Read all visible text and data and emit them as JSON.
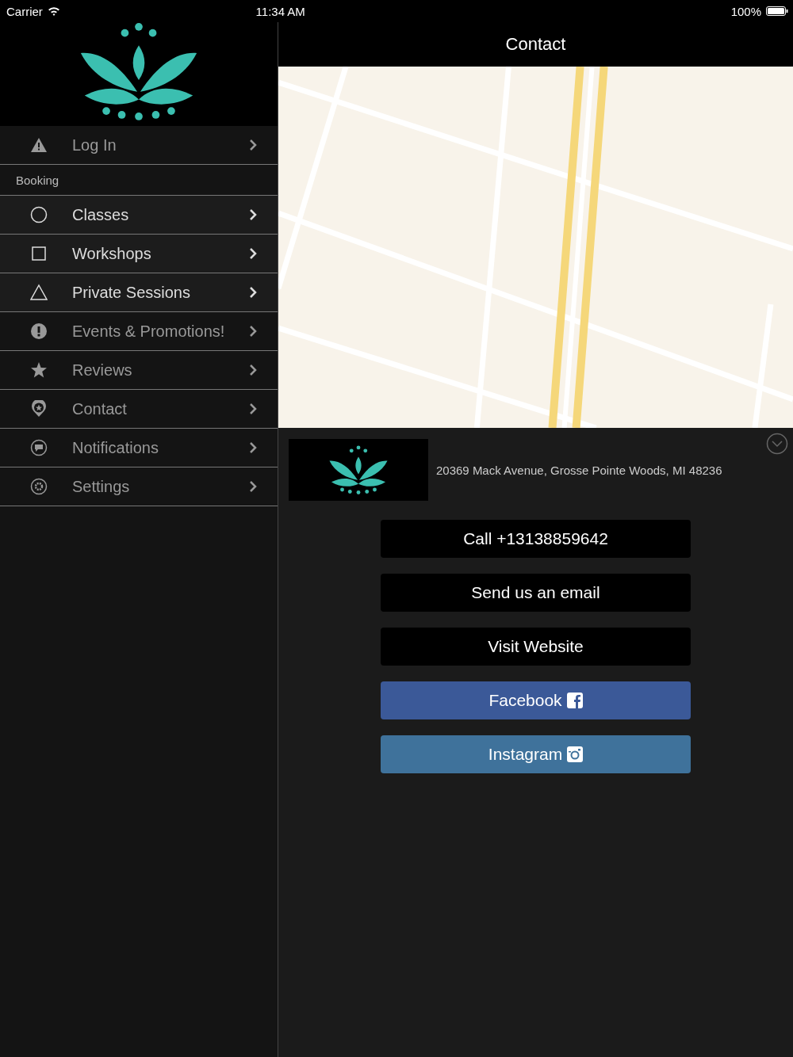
{
  "status_bar": {
    "carrier": "Carrier",
    "time": "11:34 AM",
    "battery": "100%"
  },
  "menu": [
    {
      "label": "Log In",
      "dimmed": true
    },
    {
      "label": "Classes",
      "dimmed": false,
      "section": "Booking"
    },
    {
      "label": "Workshops",
      "dimmed": false
    },
    {
      "label": "Private Sessions",
      "dimmed": false
    },
    {
      "label": "Events & Promotions!",
      "dimmed": true
    },
    {
      "label": "Reviews",
      "dimmed": true
    },
    {
      "label": "Contact",
      "dimmed": true
    },
    {
      "label": "Notifications",
      "dimmed": true
    },
    {
      "label": "Settings",
      "dimmed": true
    }
  ],
  "header": {
    "title": "Contact"
  },
  "contact": {
    "address": "20369 Mack Avenue, Grosse Pointe Woods, MI 48236",
    "buttons": [
      {
        "label": "Call +13138859642",
        "kind": "plain"
      },
      {
        "label": "Send us an email",
        "kind": "plain"
      },
      {
        "label": "Visit Website",
        "kind": "plain"
      },
      {
        "label": "Facebook",
        "kind": "facebook"
      },
      {
        "label": "Instagram",
        "kind": "instagram"
      }
    ]
  }
}
